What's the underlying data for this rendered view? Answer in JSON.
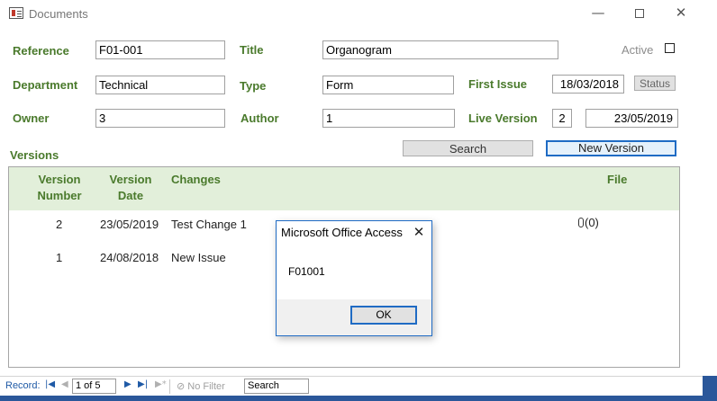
{
  "window": {
    "title": "Documents",
    "minimize_glyph": "—",
    "close_glyph": "✕"
  },
  "form": {
    "reference_label": "Reference",
    "reference_value": "F01-001",
    "title_label": "Title",
    "title_value": "Organogram",
    "active_label": "Active",
    "active_checked": false,
    "department_label": "Department",
    "department_value": "Technical",
    "type_label": "Type",
    "type_value": "Form",
    "first_issue_label": "First Issue",
    "first_issue_value": "18/03/2018",
    "status_button": "Status",
    "owner_label": "Owner",
    "owner_value": "3",
    "author_label": "Author",
    "author_value": "1",
    "live_version_label": "Live Version",
    "live_version_number": "2",
    "live_version_date": "23/05/2019",
    "versions_label": "Versions",
    "search_button": "Search",
    "new_version_button": "New Version"
  },
  "versions_table": {
    "headers": {
      "version_number_1": "Version",
      "version_number_2": "Number",
      "version_date_1": "Version",
      "version_date_2": "Date",
      "changes": "Changes",
      "file": "File"
    },
    "rows": [
      {
        "number": "2",
        "date": "23/05/2019",
        "changes": "Test Change 1",
        "file": "(0)"
      },
      {
        "number": "1",
        "date": "24/08/2018",
        "changes": "New Issue",
        "file": ""
      }
    ]
  },
  "navigation": {
    "record_label": "Record:",
    "first_glyph": "|◀",
    "prev_glyph": "◀",
    "position": "1 of 5",
    "next_glyph": "▶",
    "last_glyph": "▶|",
    "new_glyph": "▶*",
    "filter_status": "No Filter",
    "search_placeholder": "Search"
  },
  "dialog": {
    "title": "Microsoft Office Access",
    "close_glyph": "✕",
    "message": "F01001",
    "ok_button": "OK"
  },
  "colors": {
    "label_green": "#4a7a2c",
    "header_band": "#e2efda",
    "accent_blue": "#1f6bc4",
    "ribbon_blue": "#2b579a"
  }
}
